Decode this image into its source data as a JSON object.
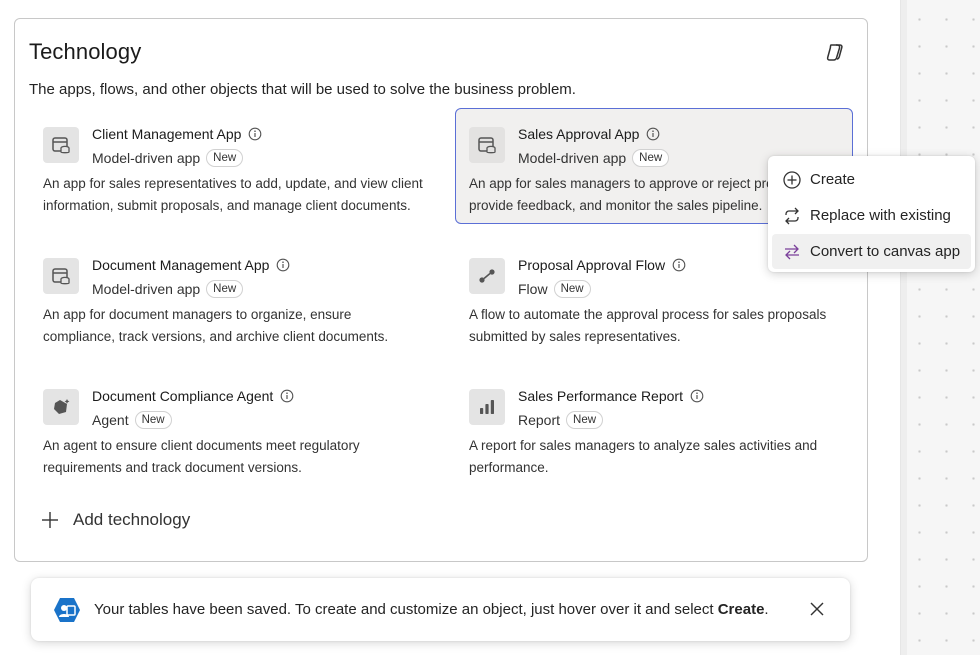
{
  "card": {
    "title": "Technology",
    "description": "The apps, flows, and other objects that will be used to solve the business problem."
  },
  "items": [
    {
      "name": "Client Management App",
      "type": "Model-driven app",
      "badge": "New",
      "icon": "model-app-icon",
      "desc1": "An app for sales representatives to add, update, and view client",
      "desc2": "information, submit proposals, and manage client documents."
    },
    {
      "name": "Sales Approval App",
      "type": "Model-driven app",
      "badge": "New",
      "icon": "model-app-icon",
      "desc1": "An app for sales managers to approve or reject proposals,",
      "desc2": "provide feedback, and monitor the sales pipeline."
    },
    {
      "name": "Document Management App",
      "type": "Model-driven app",
      "badge": "New",
      "icon": "model-app-icon",
      "desc1": "An app for document managers to organize, ensure",
      "desc2": "compliance, track versions, and archive client documents."
    },
    {
      "name": "Proposal Approval Flow",
      "type": "Flow",
      "badge": "New",
      "icon": "flow-icon",
      "desc1": "A flow to automate the approval process for sales proposals",
      "desc2": "submitted by sales representatives."
    },
    {
      "name": "Document Compliance Agent",
      "type": "Agent",
      "badge": "New",
      "icon": "agent-icon",
      "desc1": "An agent to ensure client documents meet regulatory",
      "desc2": "requirements and track document versions."
    },
    {
      "name": "Sales Performance Report",
      "type": "Report",
      "badge": "New",
      "icon": "report-icon",
      "desc1": "A report for sales managers to analyze sales activities and",
      "desc2": "performance."
    }
  ],
  "add_technology_label": "Add technology",
  "context_menu": {
    "create": "Create",
    "replace": "Replace with existing",
    "convert": "Convert to canvas app"
  },
  "toast": {
    "message": "Your tables have been saved. To create and customize an object, just hover over it and select ",
    "emphasis": "Create",
    "suffix": "."
  },
  "colors": {
    "selected_border": "#5b6fd6",
    "convert_icon": "#7a3f9a",
    "toast_icon": "#1a73c9"
  }
}
